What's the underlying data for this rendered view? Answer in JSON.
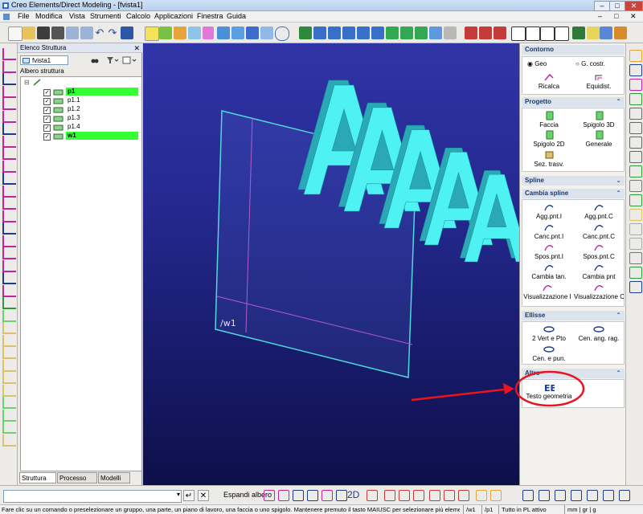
{
  "window": {
    "title": "Creo Elements/Direct Modeling - [fvista1]",
    "controls": [
      "–",
      "□",
      "✕"
    ],
    "inner_controls": [
      "–",
      "□",
      "✕"
    ]
  },
  "menu": [
    "File",
    "Modifica",
    "Vista",
    "Strumenti",
    "Calcolo",
    "Applicazioni",
    "Finestra",
    "Guida"
  ],
  "structure_panel": {
    "title": "Elenco Struttura",
    "close": "✕",
    "view_selector": "fvista1",
    "tree_label": "Albero struttura",
    "items": [
      {
        "name": "p1",
        "checked": true,
        "highlighted": true
      },
      {
        "name": "p1.1",
        "checked": true,
        "highlighted": false
      },
      {
        "name": "p1.2",
        "checked": true,
        "highlighted": false
      },
      {
        "name": "p1.3",
        "checked": true,
        "highlighted": false
      },
      {
        "name": "p1.4",
        "checked": true,
        "highlighted": false
      },
      {
        "name": "w1",
        "checked": true,
        "highlighted": true
      }
    ],
    "tabs": [
      "Struttura",
      "Processo P...",
      "Modelli"
    ]
  },
  "viewport": {
    "workplane_label": "/w1",
    "text_3d": "AAAAA"
  },
  "right_panel": {
    "title": "Contorno",
    "radio_options": [
      "Geo",
      "G. costr."
    ],
    "selected_radio": "Geo",
    "top_commands": [
      "Ricalca",
      "Equidist."
    ],
    "sections": [
      {
        "title": "Progetto",
        "commands": [
          "Faccia",
          "Spigolo 3D",
          "Spigolo 2D",
          "Generale",
          "Sez. trasv."
        ]
      },
      {
        "title": "Spline",
        "commands": []
      },
      {
        "title": "Cambia spline",
        "commands": [
          "Agg.pnt.I",
          "Agg.pnt.C",
          "Canc.pnt.I",
          "Canc.pnt.C",
          "Spos.pnt.I",
          "Spos.pnt.C",
          "Cambia tan.",
          "Cambia pnt",
          "Visualizzazione I",
          "Visualizzazione C"
        ]
      },
      {
        "title": "Ellisse",
        "commands": [
          "2 Vert e Pto",
          "Cen. ang. rag.",
          "Cen. e pun."
        ]
      },
      {
        "title": "Altro",
        "commands": [
          "Testo geometria"
        ]
      }
    ]
  },
  "bottom_toolbar": {
    "command_input": "",
    "expand_tree": "Espandi albero",
    "mode_2d": "2D"
  },
  "status_bar": {
    "message": "Fare clic su un comando o preselezionare un gruppo, una parte, un piano di lavoro, una faccia o uno spigolo. Mantenere premuto il tasto MAIUSC per selezionare più elementi",
    "workplane": "/w1",
    "part": "/p1",
    "mode": "Tutto in PL attivo",
    "units": "mm | gr | g"
  },
  "colors": {
    "highlight_green": "#33ff33",
    "viewport_top": "#3034a6",
    "viewport_bottom": "#0d0f4a",
    "text_cyan": "#4ff2f2",
    "annotation_red": "#e8141e"
  },
  "icons": [
    "app-icon",
    "new-icon",
    "open-icon",
    "save-icon",
    "undo-icon",
    "redo-icon",
    "zoom-icon",
    "pan-icon",
    "checkbox-icon",
    "folder-icon",
    "binoculars-icon",
    "filter-icon",
    "window-icon"
  ]
}
